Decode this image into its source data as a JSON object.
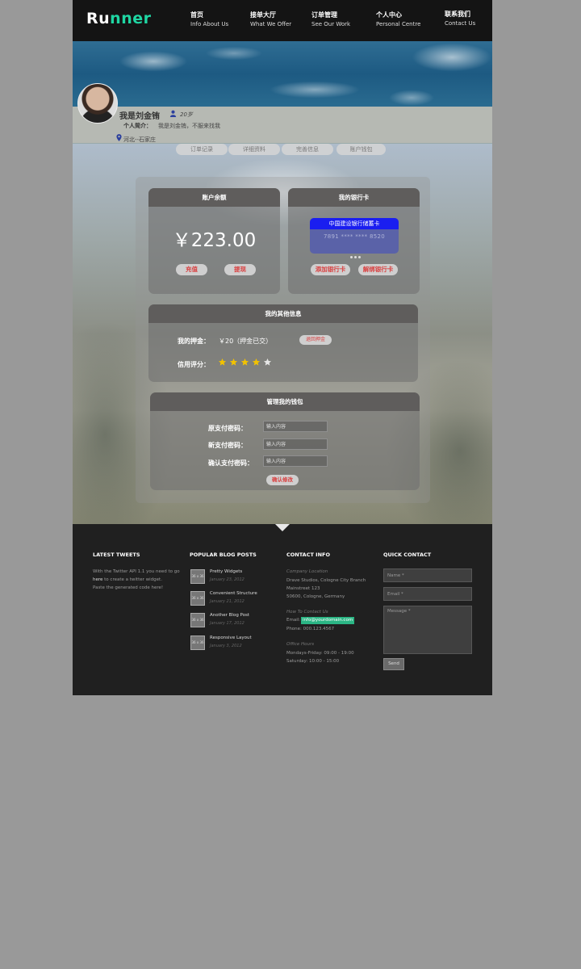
{
  "brand": {
    "logo_part1": "Ru",
    "logo_part2": "nner",
    "accent": "#1fd6a3"
  },
  "nav": [
    {
      "cn": "首页",
      "en": "Info About Us"
    },
    {
      "cn": "接单大厅",
      "en": "What We Offer"
    },
    {
      "cn": "订单管理",
      "en": "See Our Work"
    },
    {
      "cn": "个人中心",
      "en": "Personal Centre"
    },
    {
      "cn": "联系我们",
      "en": "Contact Us"
    }
  ],
  "profile": {
    "name": "我是刘金铕",
    "age": "20岁",
    "intro_label": "个人简介：",
    "intro_text": "我是刘金铕，不服来找我",
    "location": "河北--石家庄"
  },
  "tabs": [
    "订单记录",
    "详细资料",
    "完善信息",
    "账户钱包"
  ],
  "balance_card": {
    "title": "账户余额",
    "value": "￥223.00",
    "recharge": "充值",
    "withdraw": "提现"
  },
  "bank_card": {
    "title": "我的银行卡",
    "card_name": "中国建设银行储蓄卡",
    "card_number": "7891 **** **** 8520",
    "add": "添加银行卡",
    "unbind": "解绑银行卡"
  },
  "other_info": {
    "title": "我的其他信息",
    "deposit_label": "我的押金：",
    "deposit_value": "￥20（押金已交）",
    "refund": "退回押金",
    "credit_label": "信用评分：",
    "credit_stars": 4,
    "credit_max": 5,
    "star_color": "#f2c200"
  },
  "wallet": {
    "title": "管理我的钱包",
    "old_label": "原支付密码：",
    "new_label": "新支付密码：",
    "confirm_label": "确认支付密码：",
    "placeholder": "输入内容",
    "submit": "确认修改"
  },
  "footer": {
    "tweets": {
      "title": "LATEST TWEETS",
      "line1": "With the Twitter API 1.1 you need to go",
      "line2_link": "here",
      "line2_rest": " to create a twitter widget.",
      "line3": "Paste the generated code here!"
    },
    "blog": {
      "title": "POPULAR BLOG POSTS",
      "thumb": "36 x 36",
      "posts": [
        {
          "title": "Pretty Widgets",
          "date": "January 23, 2012"
        },
        {
          "title": "Convenient Structure",
          "date": "January 21, 2012"
        },
        {
          "title": "Another Blog Post",
          "date": "January 17, 2012"
        },
        {
          "title": "Responsive Layout",
          "date": "January 3, 2012"
        }
      ]
    },
    "contact": {
      "title": "CONTACT INFO",
      "location_label": "Company Location",
      "addr1": "Drave Studios, Cologne City Branch",
      "addr2": "Mainstreet 123",
      "addr3": "50600, Cologne, Germany",
      "contact_label": "How To Contact Us",
      "email_prefix": "Email:",
      "email": "info@yourdomain.com",
      "phone": "Phone: 000.123.4567",
      "hours_label": "Office Hours",
      "hours1": "Mondays-Friday: 09:00 - 19:00",
      "hours2": "Saturday: 10:00 - 15:00"
    },
    "quick": {
      "title": "QUICK CONTACT",
      "name_placeholder": "Name *",
      "email_placeholder": "Email *",
      "message_placeholder": "Message *",
      "send": "Send"
    }
  }
}
